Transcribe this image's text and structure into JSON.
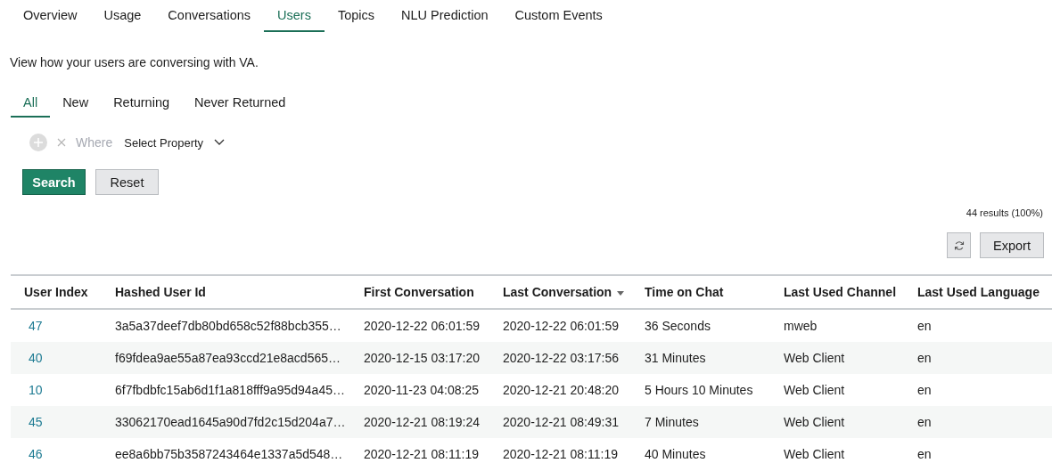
{
  "nav_tabs": [
    {
      "label": "Overview",
      "selected": false
    },
    {
      "label": "Usage",
      "selected": false
    },
    {
      "label": "Conversations",
      "selected": false
    },
    {
      "label": "Users",
      "selected": true
    },
    {
      "label": "Topics",
      "selected": false
    },
    {
      "label": "NLU Prediction",
      "selected": false
    },
    {
      "label": "Custom Events",
      "selected": false
    }
  ],
  "description": "View how your users are conversing with VA.",
  "segment_tabs": [
    {
      "label": "All",
      "selected": true
    },
    {
      "label": "New",
      "selected": false
    },
    {
      "label": "Returning",
      "selected": false
    },
    {
      "label": "Never Returned",
      "selected": false
    }
  ],
  "filter": {
    "where": "Where",
    "property": "Select Property"
  },
  "buttons": {
    "search": "Search",
    "reset": "Reset"
  },
  "results": "44 results (100%)",
  "export": "Export",
  "table": {
    "columns": [
      {
        "label": "User Index",
        "sorted": false
      },
      {
        "label": "Hashed User Id",
        "sorted": false
      },
      {
        "label": "First Conversation",
        "sorted": false
      },
      {
        "label": "Last Conversation",
        "sorted": true
      },
      {
        "label": "Time on Chat",
        "sorted": false
      },
      {
        "label": "Last Used Channel",
        "sorted": false
      },
      {
        "label": "Last Used Language",
        "sorted": false
      }
    ],
    "rows": [
      [
        "47",
        "3a5a37deef7db80bd658c52f88bcb355…",
        "2020-12-22 06:01:59",
        "2020-12-22 06:01:59",
        "36 Seconds",
        "mweb",
        "en"
      ],
      [
        "40",
        "f69fdea9ae55a87ea93ccd21e8acd565…",
        "2020-12-15 03:17:20",
        "2020-12-22 03:17:56",
        "31 Minutes",
        "Web Client",
        "en"
      ],
      [
        "10",
        "6f7fbdbfc15ab6d1f1a818fff9a95d94a45…",
        "2020-11-23 04:08:25",
        "2020-12-21 20:48:20",
        "5 Hours 10 Minutes",
        "Web Client",
        "en"
      ],
      [
        "45",
        "33062170ead1645a90d7fd2c15d204a7…",
        "2020-12-21 08:19:24",
        "2020-12-21 08:49:31",
        "7 Minutes",
        "Web Client",
        "en"
      ],
      [
        "46",
        "ee8a6bb75b3587243464e1337a5d548…",
        "2020-12-21 08:11:19",
        "2020-12-21 08:11:19",
        "40 Minutes",
        "Web Client",
        "en"
      ]
    ]
  }
}
